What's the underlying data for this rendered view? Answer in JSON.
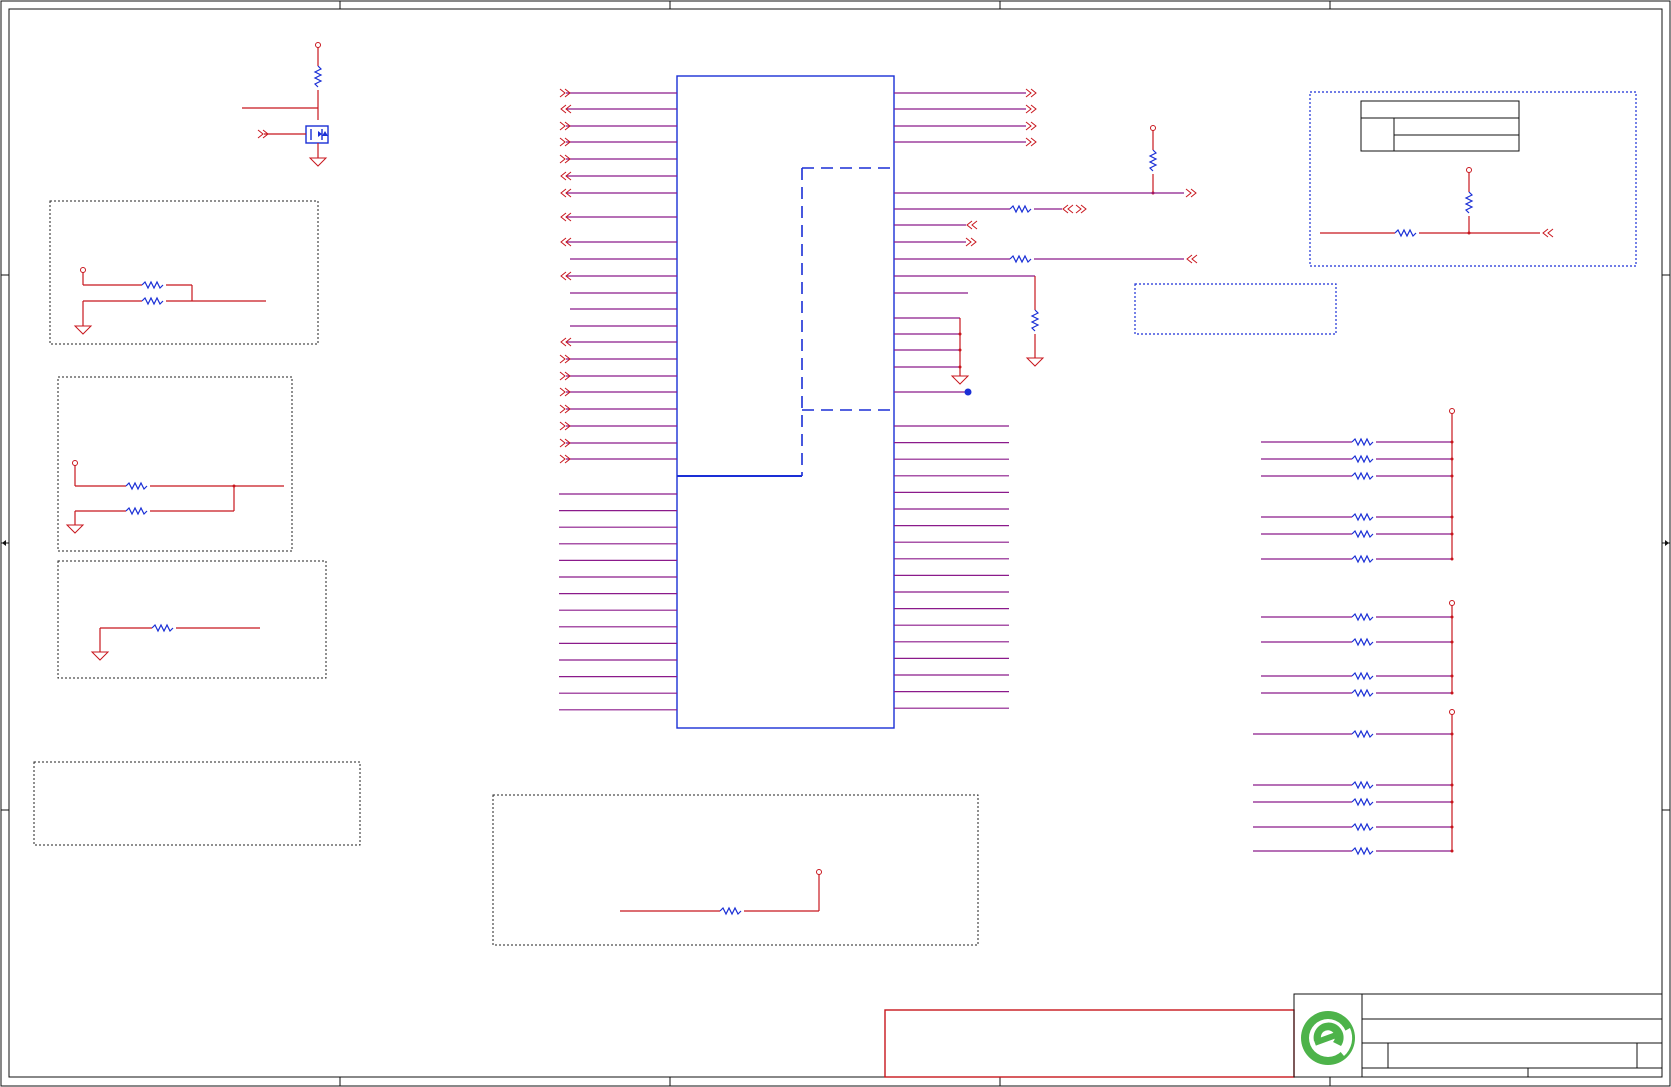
{
  "colors": {
    "wire": "#c8161d",
    "component": "#1a2fd6",
    "frame": "#111111",
    "logo_green": "#4db34a",
    "background": "#ffffff"
  },
  "logo": {
    "icon": "e-logo-icon"
  }
}
